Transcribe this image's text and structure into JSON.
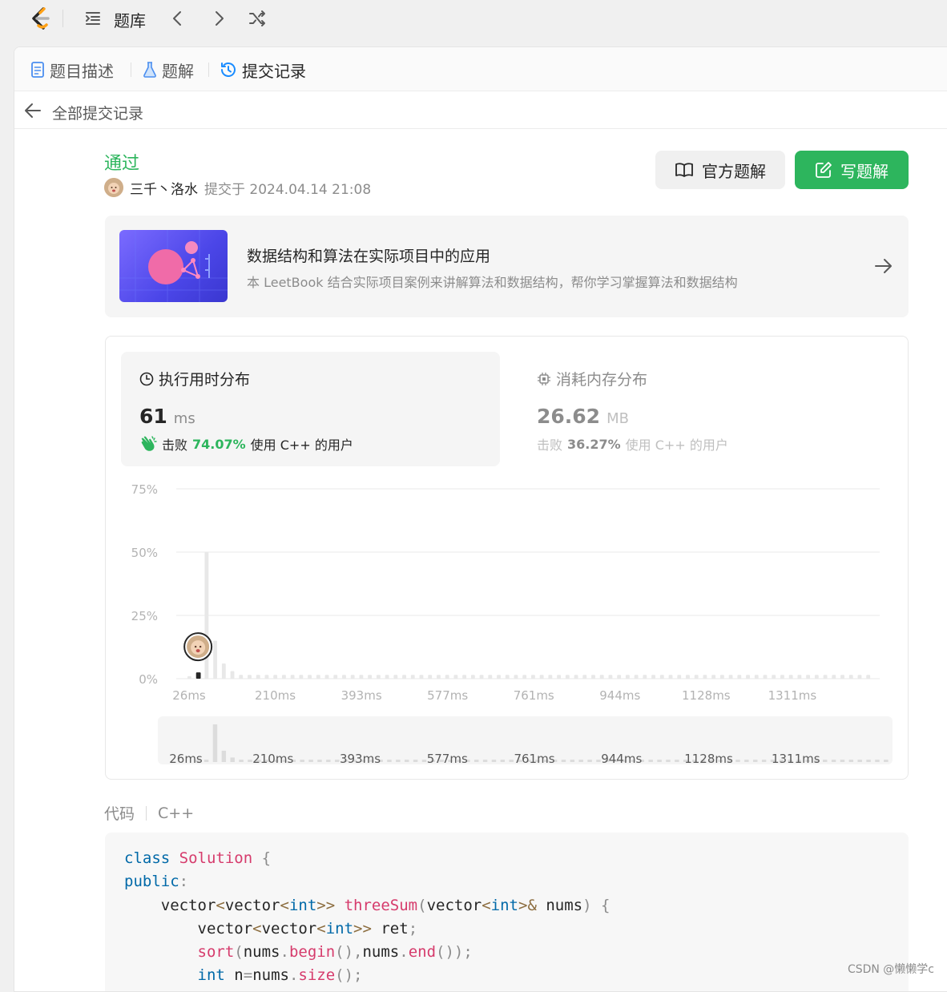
{
  "topbar": {
    "title": "题库",
    "icons": [
      "leetcode-logo-icon",
      "list-icon",
      "chevron-left-icon",
      "chevron-right-icon",
      "shuffle-icon"
    ]
  },
  "tabs": [
    {
      "label": "题目描述",
      "icon": "description-icon"
    },
    {
      "label": "题解",
      "icon": "flask-icon"
    },
    {
      "label": "提交记录",
      "icon": "history-icon",
      "active": true
    }
  ],
  "back": {
    "label": "全部提交记录"
  },
  "submission": {
    "status": "通过",
    "user": "三千丶洛水",
    "submitted": "提交于 2024.04.14 21:08",
    "official_btn": "官方题解",
    "write_btn": "写题解"
  },
  "promo": {
    "title": "数据结构和算法在实际项目中的应用",
    "subtitle": "本 LeetBook 结合实际项目案例来讲解算法和数据结构，帮你学习掌握算法和数据结构"
  },
  "runtime": {
    "title": "执行用时分布",
    "value": "61",
    "unit": "ms",
    "beat_prefix": "击败",
    "beat_pct": "74.07%",
    "beat_suffix": "使用 C++ 的用户"
  },
  "memory": {
    "title": "消耗内存分布",
    "value": "26.62",
    "unit": "MB",
    "beat_prefix": "击败",
    "beat_pct": "36.27%",
    "beat_suffix": "使用 C++ 的用户"
  },
  "chart_data": {
    "type": "bar",
    "title": "",
    "xlabel": "",
    "ylabel": "",
    "ylim": [
      0,
      75
    ],
    "y_ticks": [
      "75%",
      "50%",
      "25%",
      "0%"
    ],
    "x_ticks": [
      "26ms",
      "210ms",
      "393ms",
      "577ms",
      "761ms",
      "944ms",
      "1128ms",
      "1311ms"
    ],
    "values": [
      1,
      2.5,
      50,
      15,
      6,
      3,
      1.5,
      1.5,
      1.5,
      1.5,
      1.5,
      1.5,
      1.5,
      1.5,
      1.5,
      1.5,
      1.5,
      1.5,
      1.5,
      1.5,
      1.5,
      1.5,
      1.5,
      1.5,
      1.5,
      1.5,
      1.5,
      1.5,
      1.5,
      1.5,
      1.5,
      1.5,
      1.5,
      1.5,
      1.5,
      1.5,
      1.5,
      1.5,
      1.5,
      1.5,
      1.5,
      1.5,
      1.5,
      1.5,
      1.5,
      1.5,
      1.5,
      1.5,
      1.5,
      1.5,
      1.5,
      1.5,
      1.5,
      1.5,
      1.5,
      1.5,
      1.5,
      1.5,
      1.5,
      1.5,
      1.5,
      1.5,
      1.5,
      1.5,
      1.5,
      1.5,
      1.5,
      1.5,
      1.5,
      1.5,
      1.5,
      1.5,
      1.5,
      1.5,
      1.5,
      1.5,
      1.5,
      1.5,
      1.5,
      1.5
    ],
    "highlight_index": 1,
    "grid": true,
    "colors": {
      "bar": "#e8e8e8",
      "highlight": "#262626",
      "grid": "#e8e8e8"
    }
  },
  "code": {
    "label": "代码",
    "language": "C++"
  },
  "watermark": "CSDN @懒懒学c",
  "colors": {
    "accent": "#2db55d",
    "link_blue": "#0069a8"
  }
}
